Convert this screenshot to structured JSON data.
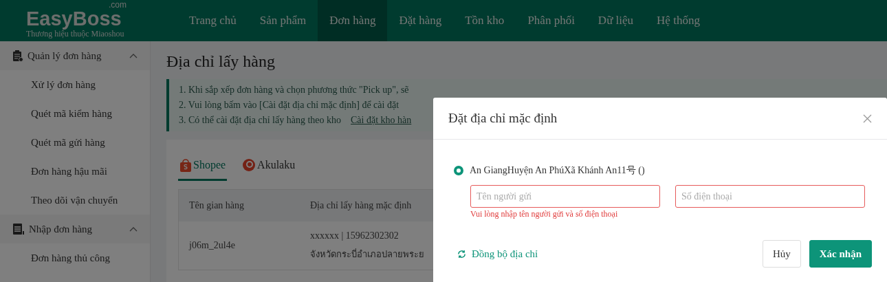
{
  "logo": {
    "name": "EasyBoss",
    "suffix": ".com",
    "tagline": "Thương hiệu thuộc Miaoshou"
  },
  "nav": [
    {
      "label": "Trang chủ",
      "selected": false
    },
    {
      "label": "Sản phẩm",
      "selected": false
    },
    {
      "label": "Đơn hàng",
      "selected": true
    },
    {
      "label": "Đặt hàng",
      "selected": false
    },
    {
      "label": "Tồn kho",
      "selected": false
    },
    {
      "label": "Phân phối",
      "selected": false
    },
    {
      "label": "Dữ liệu",
      "selected": false
    },
    {
      "label": "Hệ thống",
      "selected": false
    }
  ],
  "sidebar": [
    {
      "label": "Quản lý đơn hàng",
      "kind": "orders",
      "expanded": true,
      "children": [
        {
          "label": "Xử lý đơn hàng"
        },
        {
          "label": "Quét mã kiểm hàng"
        },
        {
          "label": "Quét mã gửi hàng"
        },
        {
          "label": "Đơn hàng hậu mãi"
        },
        {
          "label": "Theo dõi vận chuyển"
        }
      ]
    },
    {
      "label": "Nhập đơn hàng",
      "kind": "import",
      "expanded": true,
      "children": [
        {
          "label": "Đơn hàng thủ công"
        }
      ]
    }
  ],
  "page": {
    "title": "Địa chỉ lấy hàng",
    "notices": [
      "1. Khi sắp xếp đơn hàng và chọn phương thức \"Pick up\", sẽ",
      "2. Vui lòng bấm vào [Cài đặt địa chỉ mặc định] để cài đặt",
      "3. Có thể cài đặt địa chỉ lấy hàng theo kho"
    ],
    "notice_link": "Cài đặt kho hàn",
    "platform_tabs": [
      {
        "label": "Shopee",
        "kind": "shopee",
        "selected": true
      },
      {
        "label": "Akulaku",
        "kind": "akulaku",
        "selected": false
      }
    ],
    "table": {
      "columns": [
        "Tên gian hàng",
        "Địa chỉ lấy hàng mặc định"
      ],
      "rows": [
        {
          "shop": "j06m_2ul4e",
          "contact": "xxxxxx | 15962302302",
          "address": "จังหวัดกระบี่อำเภอปลายพระย"
        }
      ]
    }
  },
  "dialog": {
    "title": "Đặt địa chỉ mặc định",
    "options": [
      {
        "label": "An GiangHuyện An PhúXã Khánh An11号 ()",
        "selected": true
      }
    ],
    "sender": {
      "placeholder": "Tên người gửi"
    },
    "phone": {
      "placeholder": "Số điện thoại"
    },
    "error": "Vui lòng nhập tên người gửi và số điện thoại",
    "sync_link": "Đồng bộ địa chỉ",
    "buttons": [
      {
        "label": "Hủy",
        "kind": "secondary"
      },
      {
        "label": "Xác nhận",
        "kind": "primary"
      }
    ]
  }
}
